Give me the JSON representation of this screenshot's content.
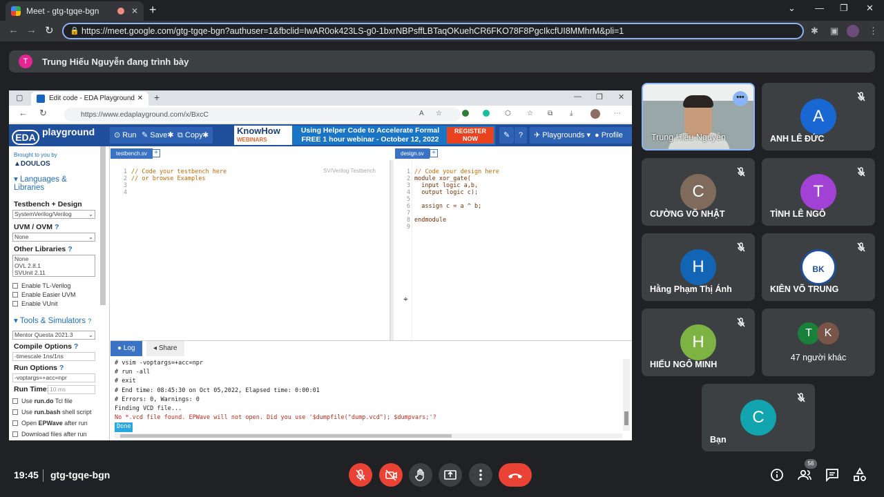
{
  "browser": {
    "tab_title": "Meet - gtg-tgqe-bgn",
    "url": "https://meet.google.com/gtg-tgqe-bgn?authuser=1&fbclid=IwAR0ok423LS-g0-1bxrNBPsffLBTaqOKuehCR6FKO78F8PgcIkcfUI8MMhrM&pli=1"
  },
  "banner": {
    "avatar_letter": "T",
    "text": "Trung Hiếu Nguyễn đang trình bày"
  },
  "shared_screen": {
    "tab_title": "Edit code - EDA Playground",
    "url": "https://www.edaplayground.com/x/BxcC",
    "header": {
      "logo_text": "EDA",
      "logo_sub": "playground",
      "run": "Run",
      "save": "Save",
      "copy": "Copy",
      "ad_brand": "KnowHow",
      "ad_brand_sub": "WEBINARS",
      "ad_line1": "Using Helper Code to Accelerate Formal",
      "ad_line2": "FREE 1 hour webinar - October 12, 2022",
      "ad_register": "REGISTER NOW",
      "playgrounds": "Playgrounds",
      "profile": "Profile"
    },
    "sidebar": {
      "brought": "Brought to you by",
      "doulos": "DOULOS",
      "languages": "Languages & Libraries",
      "tb_design": "Testbench + Design",
      "tb_design_value": "SystemVerilog/Verilog",
      "uvm": "UVM / OVM",
      "uvm_value": "None",
      "other_libs": "Other Libraries",
      "libs": [
        "None",
        "OVL 2.8.1",
        "SVUnit 2.11"
      ],
      "enable_tl": "Enable TL-Verilog",
      "enable_easier": "Enable Easier UVM",
      "enable_vunit": "Enable VUnit",
      "tools": "Tools & Simulators",
      "simulator": "Mentor Questa 2021.3",
      "compile_opts": "Compile Options",
      "compile_value": "-timescale 1ns/1ns",
      "run_opts": "Run Options",
      "run_value": "-voptargs=+acc=npr",
      "run_time": "Run Time:",
      "run_time_value": "10 ms",
      "use_rundo_a": "Use ",
      "use_rundo_b": "run.do",
      "use_rundo_c": " Tcl file",
      "use_runbash_a": "Use ",
      "use_runbash_b": "run.bash",
      "use_runbash_c": " shell script",
      "open_epwave_a": "Open ",
      "open_epwave_b": "EPWave",
      "open_epwave_c": " after run",
      "download": "Download files after run"
    },
    "testbench": {
      "tab": "testbench.sv",
      "hint": "SV/Verilog Testbench",
      "lines": [
        "// Code your testbench here",
        "// or browse Examples",
        "",
        ""
      ]
    },
    "design": {
      "tab": "design.sv",
      "lines": [
        "// Code your design here",
        "module xor_gate(",
        "  input logic a,b,",
        "  output logic c);",
        "",
        "  assign c = a ^ b;",
        "",
        "endmodule",
        ""
      ]
    },
    "log": {
      "log_tab": "Log",
      "share_tab": "Share",
      "lines": [
        "# vsim -voptargs=+acc=npr",
        "# run -all",
        "# exit",
        "# End time: 08:45:30 on Oct 05,2022, Elapsed time: 0:00:01",
        "# Errors: 0, Warnings: 0",
        "Finding VCD file..."
      ],
      "error_line": "No *.vcd file found. EPWave will not open. Did you use '$dumpfile(\"dump.vcd\"); $dumpvars;'?",
      "done": "Done"
    }
  },
  "participants": [
    {
      "name": "Trung Hiếu Nguyễn",
      "letter": "",
      "color": ""
    },
    {
      "name": "ANH LÊ ĐỨC",
      "letter": "A",
      "color": "#1967d2"
    },
    {
      "name": "CƯỜNG VÕ NHẬT",
      "letter": "C",
      "color": "#7f6a5c"
    },
    {
      "name": "TÌNH LÊ NGÔ",
      "letter": "T",
      "color": "#a142d4"
    },
    {
      "name": "Hằng Phạm Thị Ánh",
      "letter": "H",
      "color": "#1265b5"
    },
    {
      "name": "KIÊN VÕ TRUNG",
      "letter": "BK",
      "color": "#ffffff"
    },
    {
      "name": "HIẾU NGÔ MINH",
      "letter": "H",
      "color": "#7cb342"
    },
    {
      "name": "47 người khác",
      "letter": "",
      "color": ""
    },
    {
      "name": "Bạn",
      "letter": "C",
      "color": "#12a4af"
    }
  ],
  "others_avatars": [
    {
      "letter": "T",
      "color": "#188038"
    },
    {
      "letter": "K",
      "color": "#795548"
    }
  ],
  "bottom": {
    "time": "19:45",
    "meeting_code": "gtg-tgqe-bgn",
    "participant_count": "56"
  }
}
